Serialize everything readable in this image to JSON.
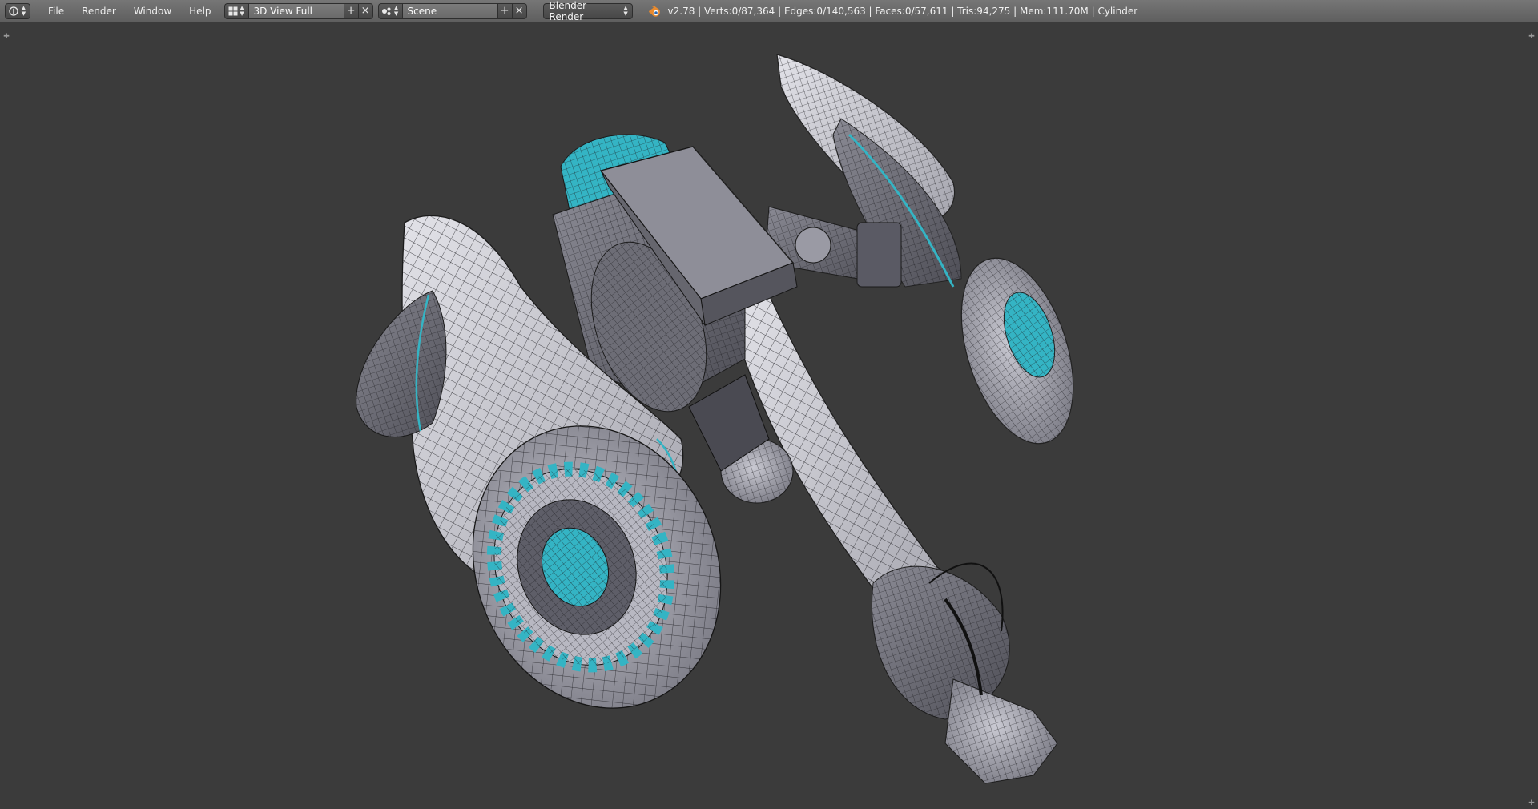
{
  "header": {
    "editor_type_icon": "info-icon",
    "menu": [
      "File",
      "Render",
      "Window",
      "Help"
    ],
    "screen_layout": {
      "icon": "screen-layout-icon",
      "value": "3D View Full"
    },
    "scene": {
      "icon": "scene-icon",
      "value": "Scene"
    },
    "render_engine": "Blender Render",
    "stats": "v2.78 | Verts:0/87,364 | Edges:0/140,563 | Faces:0/57,611 | Tris:94,275 | Mem:111.70M | Cylinder"
  },
  "viewport": {
    "background": "#3b3b3b",
    "model": "wireframe-vehicle",
    "accent_color": "#34b4c4",
    "mesh_color": "#d4d4dc"
  }
}
